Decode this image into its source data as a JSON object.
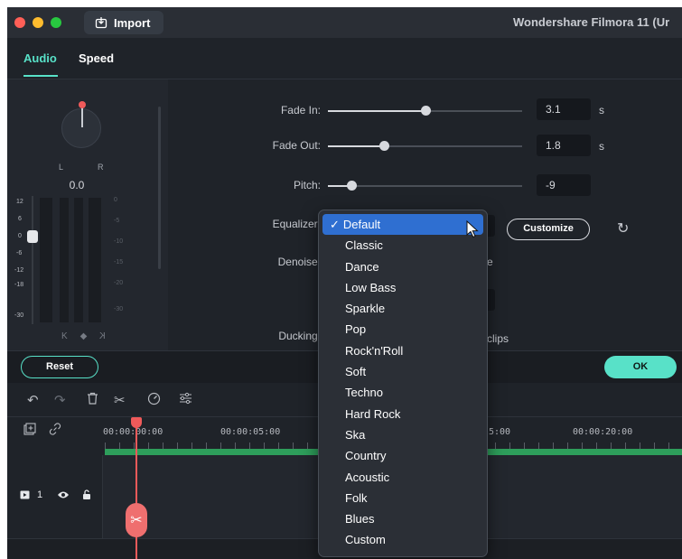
{
  "window": {
    "title": "Wondershare Filmora 11 (Ur",
    "import_label": "Import",
    "traffic_colors": [
      "#ff5f57",
      "#febc2e",
      "#28c840"
    ]
  },
  "tabs": [
    {
      "label": "Audio",
      "active": true
    },
    {
      "label": "Speed",
      "active": false
    }
  ],
  "meter": {
    "left_label": "L",
    "right_label": "R",
    "volume_value": "0.0",
    "left_scale": [
      "12",
      "6",
      "0",
      "-6",
      "-12",
      "-18",
      "-30"
    ],
    "right_scale": [
      "0",
      "-5",
      "-10",
      "-15",
      "-20",
      "-30"
    ],
    "nav_prev": "K",
    "nav_center": "◆",
    "nav_next": "K"
  },
  "settings": {
    "fade_in": {
      "label": "Fade In:",
      "value": "3.1",
      "unit": "s",
      "level": 0.5
    },
    "fade_out": {
      "label": "Fade Out:",
      "value": "1.8",
      "unit": "s",
      "level": 0.29
    },
    "pitch": {
      "label": "Pitch:",
      "value": "-9",
      "level": 0.12
    },
    "equalizer_label": "Equalizer:",
    "denoise_label": "Denoise:",
    "ducking_label": "Ducking:",
    "customize_label": "Customize",
    "partial_e": "e",
    "partial_clips": "clips"
  },
  "footer": {
    "reset_label": "Reset",
    "ok_label": "OK"
  },
  "timeline": {
    "ruler_labels": [
      "00:00:00:00",
      "00:00:05:00",
      "5:00",
      "00:00:20:00"
    ],
    "track_number": "1"
  },
  "equalizer_menu": {
    "selected": "Default",
    "options": [
      "Default",
      "Classic",
      "Dance",
      "Low Bass",
      "Sparkle",
      "Pop",
      "Rock'n'Roll",
      "Soft",
      "Techno",
      "Hard Rock",
      "Ska",
      "Country",
      "Acoustic",
      "Folk",
      "Blues",
      "Custom"
    ]
  },
  "colors": {
    "accent": "#58e1c8",
    "selection": "#2f6fd1",
    "playhead": "#ef5a5a",
    "track_green": "#2e9e5b"
  }
}
